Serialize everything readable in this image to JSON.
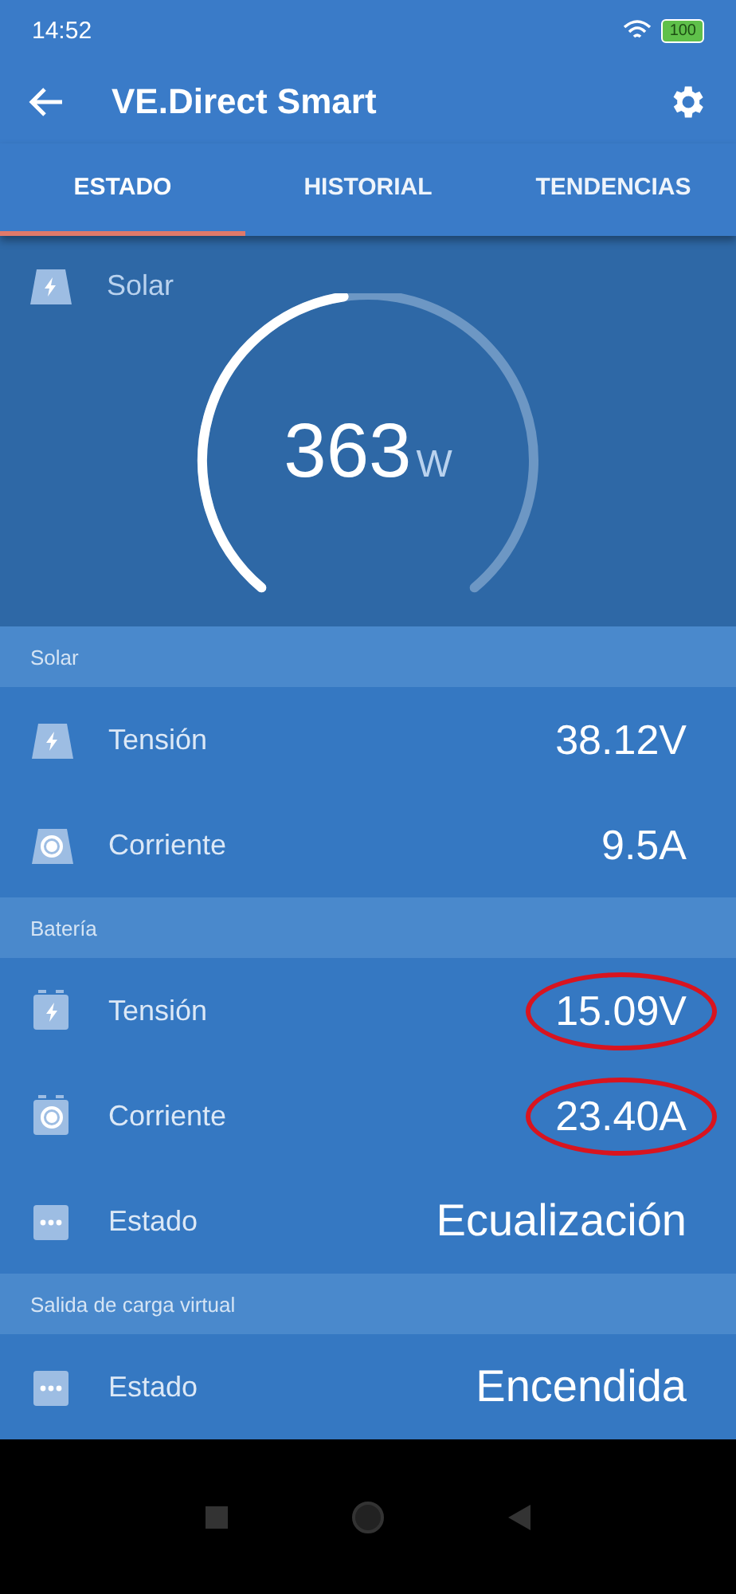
{
  "status_bar": {
    "time": "14:52",
    "battery": "100"
  },
  "app_bar": {
    "title": "VE.Direct Smart"
  },
  "tabs": [
    {
      "label": "ESTADO",
      "selected": true
    },
    {
      "label": "HISTORIAL",
      "selected": false
    },
    {
      "label": "TENDENCIAS",
      "selected": false
    }
  ],
  "gauge": {
    "label": "Solar",
    "value": "363",
    "unit": "W"
  },
  "sections": [
    {
      "title": "Solar",
      "rows": [
        {
          "kind": "panel-bolt",
          "label": "Tensión",
          "value": "38.12V",
          "circled": false
        },
        {
          "kind": "panel-circle",
          "label": "Corriente",
          "value": "9.5A",
          "circled": false
        }
      ]
    },
    {
      "title": "Batería",
      "rows": [
        {
          "kind": "battery-bolt",
          "label": "Tensión",
          "value": "15.09V",
          "circled": true
        },
        {
          "kind": "battery-circle",
          "label": "Corriente",
          "value": "23.40A",
          "circled": true
        },
        {
          "kind": "dots",
          "label": "Estado",
          "value": "Ecualización",
          "circled": false
        }
      ]
    },
    {
      "title": "Salida de carga virtual",
      "rows": [
        {
          "kind": "dots",
          "label": "Estado",
          "value": "Encendida",
          "circled": false
        }
      ]
    }
  ]
}
